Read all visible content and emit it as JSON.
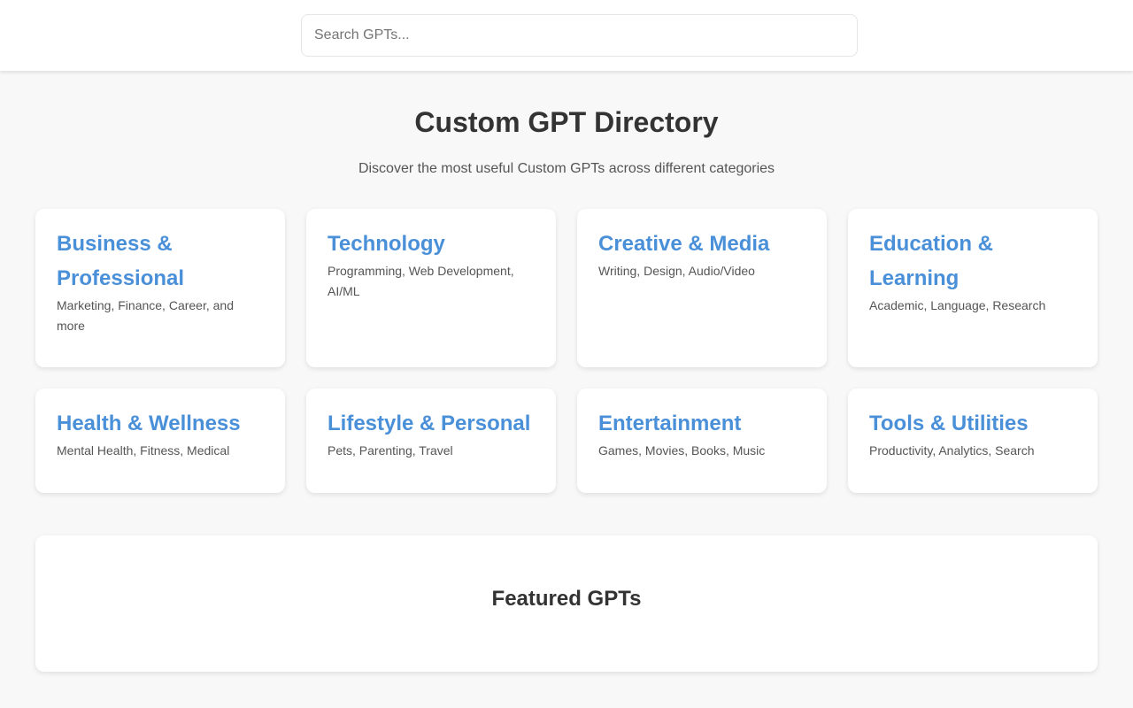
{
  "search": {
    "placeholder": "Search GPTs...",
    "value": ""
  },
  "header": {
    "title": "Custom GPT Directory",
    "subtitle": "Discover the most useful Custom GPTs across different categories"
  },
  "categories": [
    {
      "title": "Business & Professional",
      "desc": "Marketing, Finance, Career, and more"
    },
    {
      "title": "Technology",
      "desc": "Programming, Web Development, AI/ML"
    },
    {
      "title": "Creative & Media",
      "desc": "Writing, Design, Audio/Video"
    },
    {
      "title": "Education & Learning",
      "desc": "Academic, Language, Research"
    },
    {
      "title": "Health & Wellness",
      "desc": "Mental Health, Fitness, Medical"
    },
    {
      "title": "Lifestyle & Personal",
      "desc": "Pets, Parenting, Travel"
    },
    {
      "title": "Entertainment",
      "desc": "Games, Movies, Books, Music"
    },
    {
      "title": "Tools & Utilities",
      "desc": "Productivity, Analytics, Search"
    }
  ],
  "featured": {
    "title": "Featured GPTs"
  },
  "colors": {
    "accent": "#4a90d9",
    "background": "#f8f8f8",
    "card": "#ffffff",
    "text": "#333333",
    "muted": "#555555"
  }
}
